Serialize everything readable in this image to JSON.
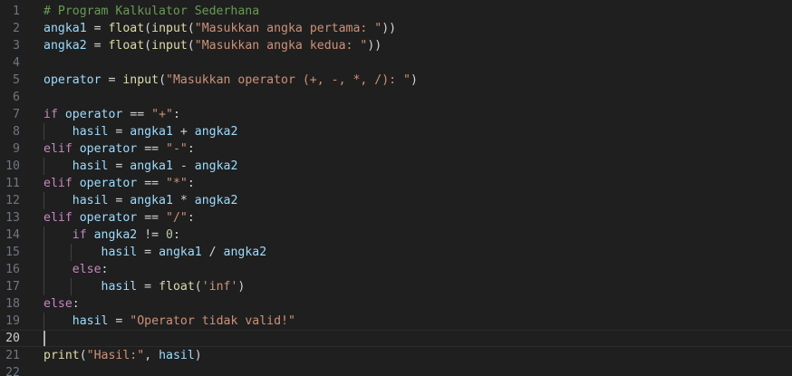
{
  "editor": {
    "active_line": 20,
    "colors": {
      "background": "#1f1f1f",
      "line_number": "#6e7681",
      "comment": "#6a9955",
      "variable": "#9cdcfe",
      "function": "#dcdcaa",
      "string": "#ce9178",
      "keyword": "#c586c0",
      "number": "#b5cea8",
      "operator": "#d4d4d4"
    },
    "lines": [
      {
        "number": "1",
        "tokens": [
          {
            "t": "comment",
            "v": "# Program Kalkulator Sederhana"
          }
        ]
      },
      {
        "number": "2",
        "tokens": [
          {
            "t": "var",
            "v": "angka1"
          },
          {
            "t": "op",
            "v": " = "
          },
          {
            "t": "fn",
            "v": "float"
          },
          {
            "t": "op",
            "v": "("
          },
          {
            "t": "fn",
            "v": "input"
          },
          {
            "t": "op",
            "v": "("
          },
          {
            "t": "str",
            "v": "\"Masukkan angka pertama: \""
          },
          {
            "t": "op",
            "v": "))"
          }
        ]
      },
      {
        "number": "3",
        "tokens": [
          {
            "t": "var",
            "v": "angka2"
          },
          {
            "t": "op",
            "v": " = "
          },
          {
            "t": "fn",
            "v": "float"
          },
          {
            "t": "op",
            "v": "("
          },
          {
            "t": "fn",
            "v": "input"
          },
          {
            "t": "op",
            "v": "("
          },
          {
            "t": "str",
            "v": "\"Masukkan angka kedua: \""
          },
          {
            "t": "op",
            "v": "))"
          }
        ]
      },
      {
        "number": "4",
        "tokens": []
      },
      {
        "number": "5",
        "tokens": [
          {
            "t": "var",
            "v": "operator"
          },
          {
            "t": "op",
            "v": " = "
          },
          {
            "t": "fn",
            "v": "input"
          },
          {
            "t": "op",
            "v": "("
          },
          {
            "t": "str",
            "v": "\"Masukkan operator (+, -, *, /): \""
          },
          {
            "t": "op",
            "v": ")"
          }
        ]
      },
      {
        "number": "6",
        "tokens": []
      },
      {
        "number": "7",
        "tokens": [
          {
            "t": "kw",
            "v": "if"
          },
          {
            "t": "op",
            "v": " "
          },
          {
            "t": "var",
            "v": "operator"
          },
          {
            "t": "op",
            "v": " == "
          },
          {
            "t": "str",
            "v": "\"+\""
          },
          {
            "t": "op",
            "v": ":"
          }
        ]
      },
      {
        "number": "8",
        "tokens": [
          {
            "t": "op",
            "v": "    "
          },
          {
            "t": "var",
            "v": "hasil"
          },
          {
            "t": "op",
            "v": " = "
          },
          {
            "t": "var",
            "v": "angka1"
          },
          {
            "t": "op",
            "v": " + "
          },
          {
            "t": "var",
            "v": "angka2"
          }
        ]
      },
      {
        "number": "9",
        "tokens": [
          {
            "t": "kw",
            "v": "elif"
          },
          {
            "t": "op",
            "v": " "
          },
          {
            "t": "var",
            "v": "operator"
          },
          {
            "t": "op",
            "v": " == "
          },
          {
            "t": "str",
            "v": "\"-\""
          },
          {
            "t": "op",
            "v": ":"
          }
        ]
      },
      {
        "number": "10",
        "tokens": [
          {
            "t": "op",
            "v": "    "
          },
          {
            "t": "var",
            "v": "hasil"
          },
          {
            "t": "op",
            "v": " = "
          },
          {
            "t": "var",
            "v": "angka1"
          },
          {
            "t": "op",
            "v": " - "
          },
          {
            "t": "var",
            "v": "angka2"
          }
        ]
      },
      {
        "number": "11",
        "tokens": [
          {
            "t": "kw",
            "v": "elif"
          },
          {
            "t": "op",
            "v": " "
          },
          {
            "t": "var",
            "v": "operator"
          },
          {
            "t": "op",
            "v": " == "
          },
          {
            "t": "str",
            "v": "\"*\""
          },
          {
            "t": "op",
            "v": ":"
          }
        ]
      },
      {
        "number": "12",
        "tokens": [
          {
            "t": "op",
            "v": "    "
          },
          {
            "t": "var",
            "v": "hasil"
          },
          {
            "t": "op",
            "v": " = "
          },
          {
            "t": "var",
            "v": "angka1"
          },
          {
            "t": "op",
            "v": " * "
          },
          {
            "t": "var",
            "v": "angka2"
          }
        ]
      },
      {
        "number": "13",
        "tokens": [
          {
            "t": "kw",
            "v": "elif"
          },
          {
            "t": "op",
            "v": " "
          },
          {
            "t": "var",
            "v": "operator"
          },
          {
            "t": "op",
            "v": " == "
          },
          {
            "t": "str",
            "v": "\"/\""
          },
          {
            "t": "op",
            "v": ":"
          }
        ]
      },
      {
        "number": "14",
        "tokens": [
          {
            "t": "op",
            "v": "    "
          },
          {
            "t": "kw",
            "v": "if"
          },
          {
            "t": "op",
            "v": " "
          },
          {
            "t": "var",
            "v": "angka2"
          },
          {
            "t": "op",
            "v": " != "
          },
          {
            "t": "num",
            "v": "0"
          },
          {
            "t": "op",
            "v": ":"
          }
        ]
      },
      {
        "number": "15",
        "tokens": [
          {
            "t": "op",
            "v": "        "
          },
          {
            "t": "var",
            "v": "hasil"
          },
          {
            "t": "op",
            "v": " = "
          },
          {
            "t": "var",
            "v": "angka1"
          },
          {
            "t": "op",
            "v": " / "
          },
          {
            "t": "var",
            "v": "angka2"
          }
        ]
      },
      {
        "number": "16",
        "tokens": [
          {
            "t": "op",
            "v": "    "
          },
          {
            "t": "kw",
            "v": "else"
          },
          {
            "t": "op",
            "v": ":"
          }
        ]
      },
      {
        "number": "17",
        "tokens": [
          {
            "t": "op",
            "v": "        "
          },
          {
            "t": "var",
            "v": "hasil"
          },
          {
            "t": "op",
            "v": " = "
          },
          {
            "t": "fn",
            "v": "float"
          },
          {
            "t": "op",
            "v": "("
          },
          {
            "t": "str",
            "v": "'inf'"
          },
          {
            "t": "op",
            "v": ")"
          }
        ]
      },
      {
        "number": "18",
        "tokens": [
          {
            "t": "kw",
            "v": "else"
          },
          {
            "t": "op",
            "v": ":"
          }
        ]
      },
      {
        "number": "19",
        "tokens": [
          {
            "t": "op",
            "v": "    "
          },
          {
            "t": "var",
            "v": "hasil"
          },
          {
            "t": "op",
            "v": " = "
          },
          {
            "t": "str",
            "v": "\"Operator tidak valid!\""
          }
        ]
      },
      {
        "number": "20",
        "tokens": []
      },
      {
        "number": "21",
        "tokens": [
          {
            "t": "fn",
            "v": "print"
          },
          {
            "t": "op",
            "v": "("
          },
          {
            "t": "str",
            "v": "\"Hasil:\""
          },
          {
            "t": "op",
            "v": ", "
          },
          {
            "t": "var",
            "v": "hasil"
          },
          {
            "t": "op",
            "v": ")"
          }
        ]
      },
      {
        "number": "22",
        "tokens": []
      }
    ]
  }
}
